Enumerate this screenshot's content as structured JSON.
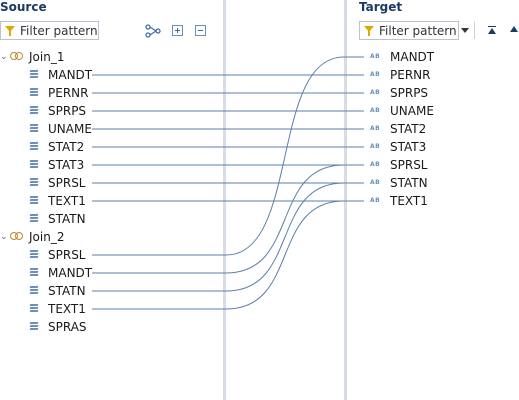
{
  "source": {
    "title": "Source",
    "filter_placeholder": "Filter pattern",
    "joins": [
      {
        "name": "Join_1",
        "fields": [
          "MANDT",
          "PERNR",
          "SPRPS",
          "UNAME",
          "STAT2",
          "STAT3",
          "SPRSL",
          "TEXT1",
          "STATN"
        ]
      },
      {
        "name": "Join_2",
        "fields": [
          "SPRSL",
          "MANDT",
          "STATN",
          "TEXT1",
          "SPRAS"
        ]
      }
    ]
  },
  "target": {
    "title": "Target",
    "filter_placeholder": "Filter pattern",
    "fields": [
      "MANDT",
      "PERNR",
      "SPRPS",
      "UNAME",
      "STAT2",
      "STAT3",
      "SPRSL",
      "STATN",
      "TEXT1"
    ],
    "field_type_label": "AB"
  },
  "colors": {
    "link": "#5b7fa8",
    "title": "#1b3a66",
    "separator": "#d6dde6"
  },
  "icons": {
    "filter": "funnel-icon",
    "auto_map": "auto-map-icon",
    "expand_all": "expand-all-icon",
    "collapse_all": "collapse-all-icon",
    "dropdown": "chevron-down-icon",
    "move_top": "move-to-top-icon"
  },
  "mappings": [
    {
      "source": "Join_1.MANDT",
      "target": "PERNR"
    },
    {
      "source": "Join_1.PERNR",
      "target": "SPRPS"
    },
    {
      "source": "Join_1.SPRPS",
      "target": "UNAME"
    },
    {
      "source": "Join_1.UNAME",
      "target": "STAT2"
    },
    {
      "source": "Join_1.STAT2",
      "target": "STAT3"
    },
    {
      "source": "Join_1.STAT3",
      "target": "SPRSL"
    },
    {
      "source": "Join_1.SPRSL",
      "target": "STATN"
    },
    {
      "source": "Join_1.TEXT1",
      "target": "TEXT1"
    },
    {
      "source": "Join_2.SPRSL",
      "target": "MANDT"
    },
    {
      "source": "Join_2.MANDT",
      "target": "SPRSL"
    },
    {
      "source": "Join_2.STATN",
      "target": "STATN"
    },
    {
      "source": "Join_2.TEXT1",
      "target": "TEXT1"
    }
  ]
}
